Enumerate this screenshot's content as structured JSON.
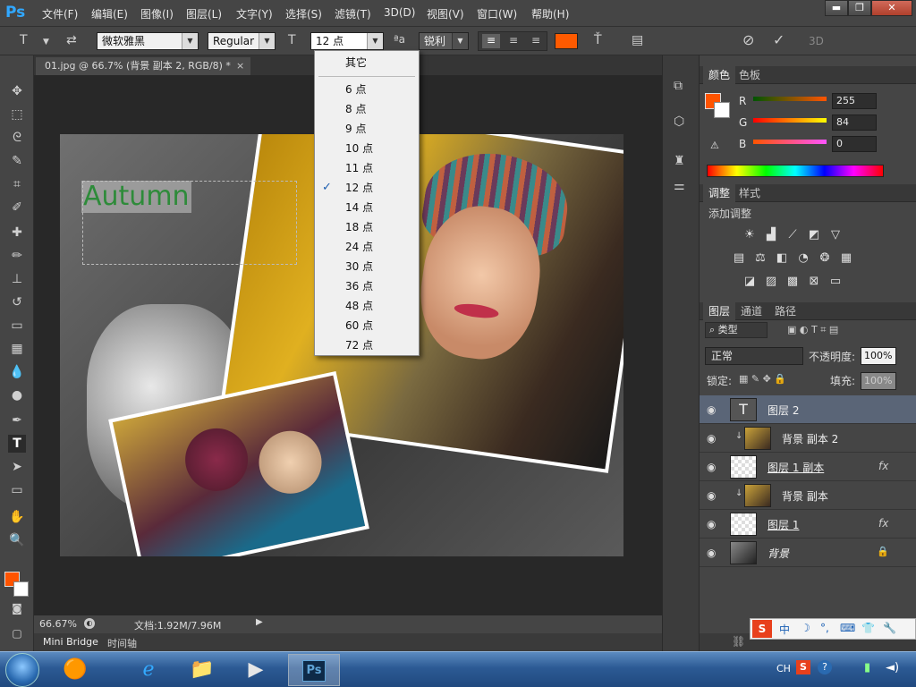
{
  "app": {
    "logo": "Ps",
    "accent": "#31a8ff"
  },
  "menu": [
    "文件(F)",
    "编辑(E)",
    "图像(I)",
    "图层(L)",
    "文字(Y)",
    "选择(S)",
    "滤镜(T)",
    "3D(D)",
    "视图(V)",
    "窗口(W)",
    "帮助(H)"
  ],
  "window_controls": {
    "minimize": "▬",
    "restore": "❐",
    "close": "✕"
  },
  "options": {
    "font_family": "微软雅黑",
    "font_style": "Regular",
    "font_size": "12 点",
    "aa_label": "ªa",
    "antialias": "锐利",
    "text_color": "#ff5a00",
    "3d_label": "3D"
  },
  "document": {
    "tab_title": "01.jpg @ 66.7% (背景 副本 2, RGB/8) *",
    "close": "×",
    "canvas_text": "Autumn",
    "text_color": "#2e8b3a"
  },
  "status": {
    "zoom": "66.67%",
    "doc_info": "文档:1.92M/7.96M"
  },
  "bottom_tabs": [
    "Mini Bridge",
    "时间轴"
  ],
  "font_size_dropdown": {
    "other": "其它",
    "items": [
      "6 点",
      "8 点",
      "9 点",
      "10 点",
      "11 点",
      "12 点",
      "14 点",
      "18 点",
      "24 点",
      "30 点",
      "36 点",
      "48 点",
      "60 点",
      "72 点"
    ],
    "selected": "12 点",
    "check": "✓"
  },
  "color_panel": {
    "tabs": [
      "颜色",
      "色板"
    ],
    "channels": [
      {
        "label": "R",
        "value": "255"
      },
      {
        "label": "G",
        "value": "84"
      },
      {
        "label": "B",
        "value": "0"
      }
    ],
    "fg_color": "#ff5400"
  },
  "adjust_panel": {
    "tabs": [
      "调整",
      "样式"
    ],
    "title": "添加调整"
  },
  "layers_panel": {
    "tabs": [
      "图层",
      "通道",
      "路径"
    ],
    "filter": "类型",
    "blend_mode": "正常",
    "opacity_label": "不透明度:",
    "opacity": "100%",
    "lock_label": "锁定:",
    "fill_label": "填充:",
    "fill": "100%",
    "layers": [
      {
        "name": "图层 2",
        "kind": "text",
        "selected": true
      },
      {
        "name": "背景 副本 2",
        "kind": "photo",
        "clip": true
      },
      {
        "name": "图层 1 副本",
        "kind": "transparent",
        "fx": "fx"
      },
      {
        "name": "背景 副本",
        "kind": "photo",
        "clip": true
      },
      {
        "name": "图层 1",
        "kind": "transparent",
        "fx": "fx"
      },
      {
        "name": "背景",
        "kind": "bg",
        "locked": true
      }
    ]
  },
  "taskbar": {
    "ime": [
      "中",
      "☽",
      "°,",
      "⌨",
      "👕",
      "🔧"
    ],
    "tray": [
      "CH",
      "S",
      "?",
      "▮",
      "◄)"
    ]
  }
}
